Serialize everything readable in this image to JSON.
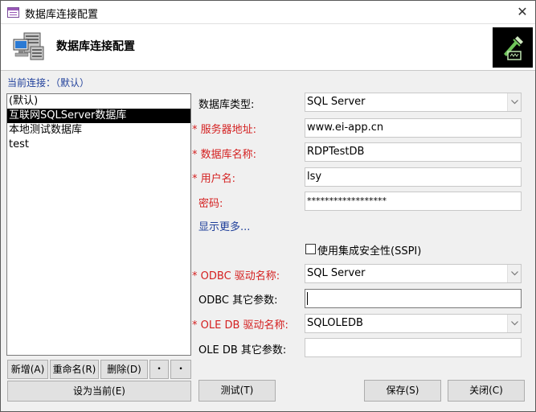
{
  "window": {
    "title": "数据库连接配置"
  },
  "header": {
    "title": "数据库连接配置"
  },
  "current_connection_label": "当前连接：（默认）",
  "connections": [
    "(默认)",
    "互联网SQLServer数据库",
    "本地测试数据库",
    "test"
  ],
  "selected_connection_index": 1,
  "list_buttons": {
    "add": "新增(A)",
    "rename": "重命名(R)",
    "delete": "删除(D)",
    "move_up": "•",
    "move_down": "•",
    "set_current": "设为当前(E)"
  },
  "form": {
    "db_type_label": "数据库类型:",
    "db_type_value": "SQL Server",
    "server_label": "* 服务器地址:",
    "server_value": "www.ei-app.cn",
    "db_name_label": "* 数据库名称:",
    "db_name_value": "RDPTestDB",
    "user_label": "* 用户名:",
    "user_value": "lsy",
    "password_label": "密码:",
    "password_value": "******************",
    "show_more": "显示更多...",
    "sspi_label": "使用集成安全性(SSPI)",
    "sspi_checked": false,
    "odbc_driver_label": "* ODBC 驱动名称:",
    "odbc_driver_value": "SQL Server",
    "odbc_params_label": "ODBC 其它参数:",
    "odbc_params_value": "",
    "oledb_driver_label": "* OLE DB 驱动名称:",
    "oledb_driver_value": "SQLOLEDB",
    "oledb_params_label": "OLE DB 其它参数:",
    "oledb_params_value": ""
  },
  "footer_buttons": {
    "test": "测试(T)",
    "save": "保存(S)",
    "close": "关闭(C)"
  },
  "colors": {
    "required_label": "#d42020",
    "link": "#1f3f9a",
    "selection_bg": "#000000"
  }
}
